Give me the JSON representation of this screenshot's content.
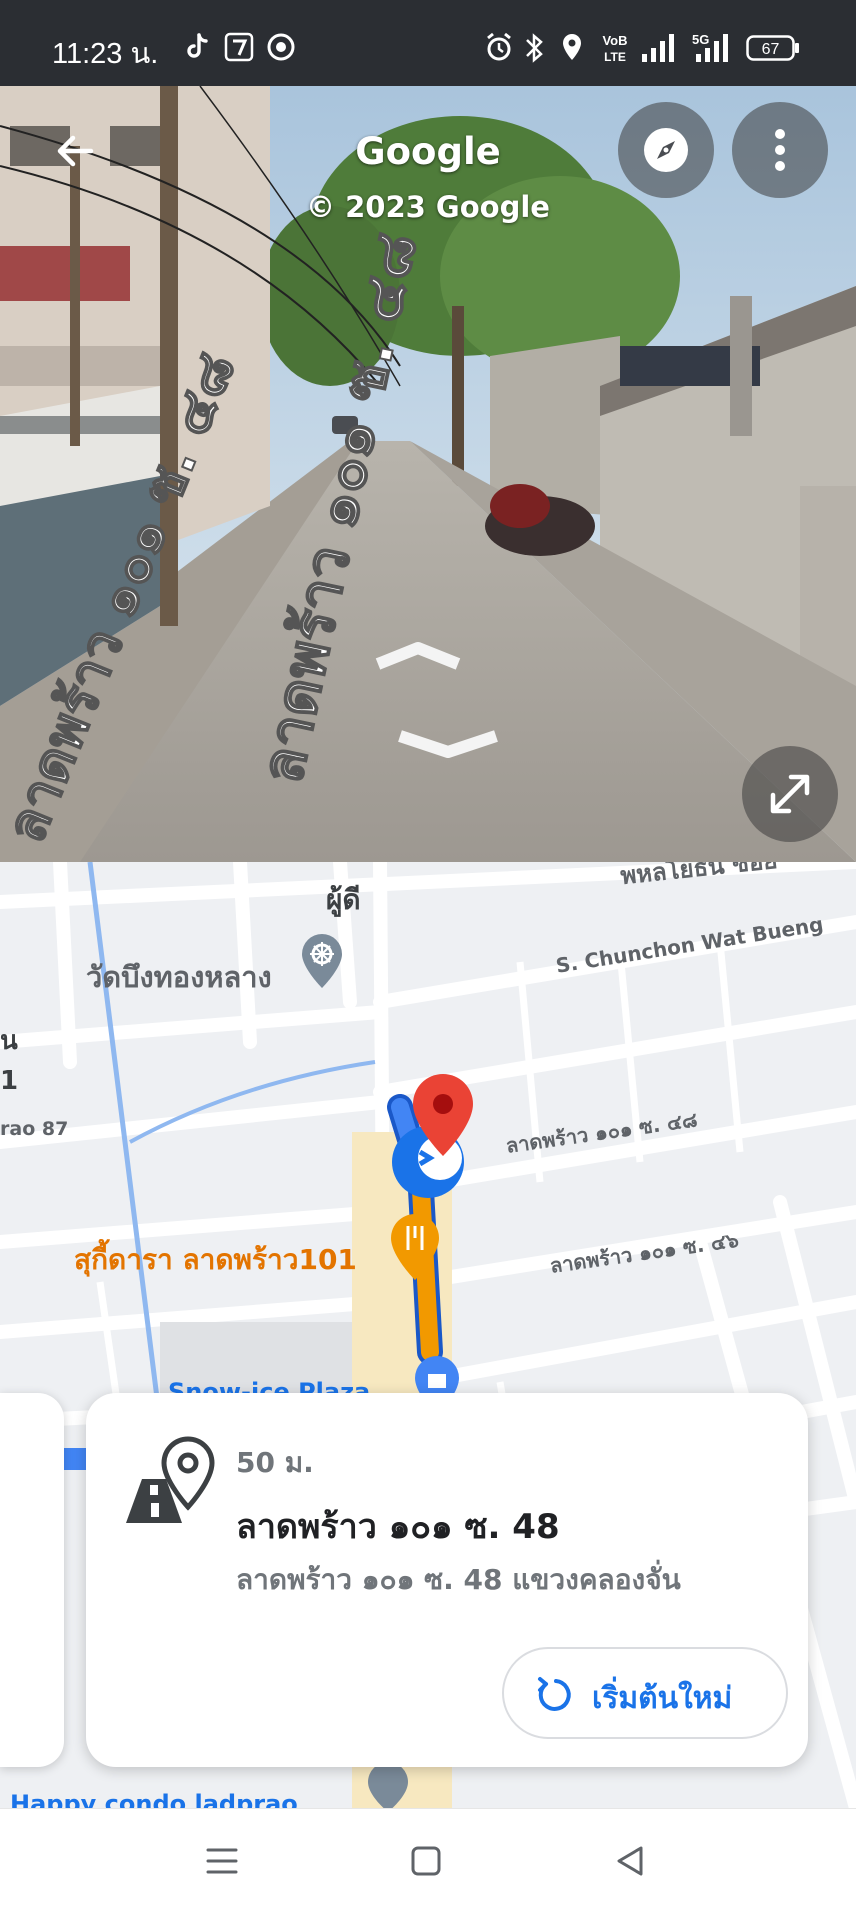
{
  "status_bar": {
    "time": "11:23 น.",
    "battery": "67",
    "network": "5G",
    "volte": "VoLTE",
    "icons": [
      "tiktok-icon",
      "seven-eleven-icon",
      "chrome-icon",
      "alarm-icon",
      "bluetooth-icon",
      "location-icon",
      "volte-icon",
      "signal-icon",
      "5g-signal-icon",
      "battery-icon"
    ]
  },
  "street_view": {
    "title": "Google",
    "copyright": "© 2023 Google",
    "road_label": "ลาดพร้าว ๑๐๑ ซ. ๔๘",
    "buttons": {
      "back": "back-arrow-icon",
      "compass": "compass-icon",
      "more": "more-vert-icon",
      "expand": "expand-icon"
    }
  },
  "map": {
    "labels": {
      "puudee": "ผู้ดี",
      "temple": "วัดบึงทองหลาง",
      "chunchon": "S. Chunchon Wat Bueng",
      "soi48": "ลาดพร้าว ๑๐๑ ซ. ๔๘",
      "soi46": "ลาดพร้าว ๑๐๑ ซ. ๔๖",
      "restaurant": "สุกี้ดารา ลาดพร้าว101",
      "plaza": "Snow-ice Plaza",
      "condo": "Happy condo ladprao",
      "left_edge_1": "น",
      "left_edge_2": "1",
      "left_edge_3": "rao 87",
      "top_right": "พหลโยธิน ซอย"
    },
    "colors": {
      "route_blue": "#4285f4",
      "route_orange": "#f29900",
      "pin_red": "#ea4335",
      "restaurant_orange": "#e37400",
      "poi_grey": "#7a8a99"
    }
  },
  "card": {
    "distance": "50 ม.",
    "title": "ลาดพร้าว ๑๐๑ ซ. 48",
    "subtitle": "ลาดพร้าว ๑๐๑ ซ. 48 แขวงคลองจั่น",
    "restart_label": "เริ่มต้นใหม่"
  },
  "nav_bar": {
    "buttons": [
      "menu-icon",
      "home-square-icon",
      "back-triangle-icon"
    ]
  }
}
